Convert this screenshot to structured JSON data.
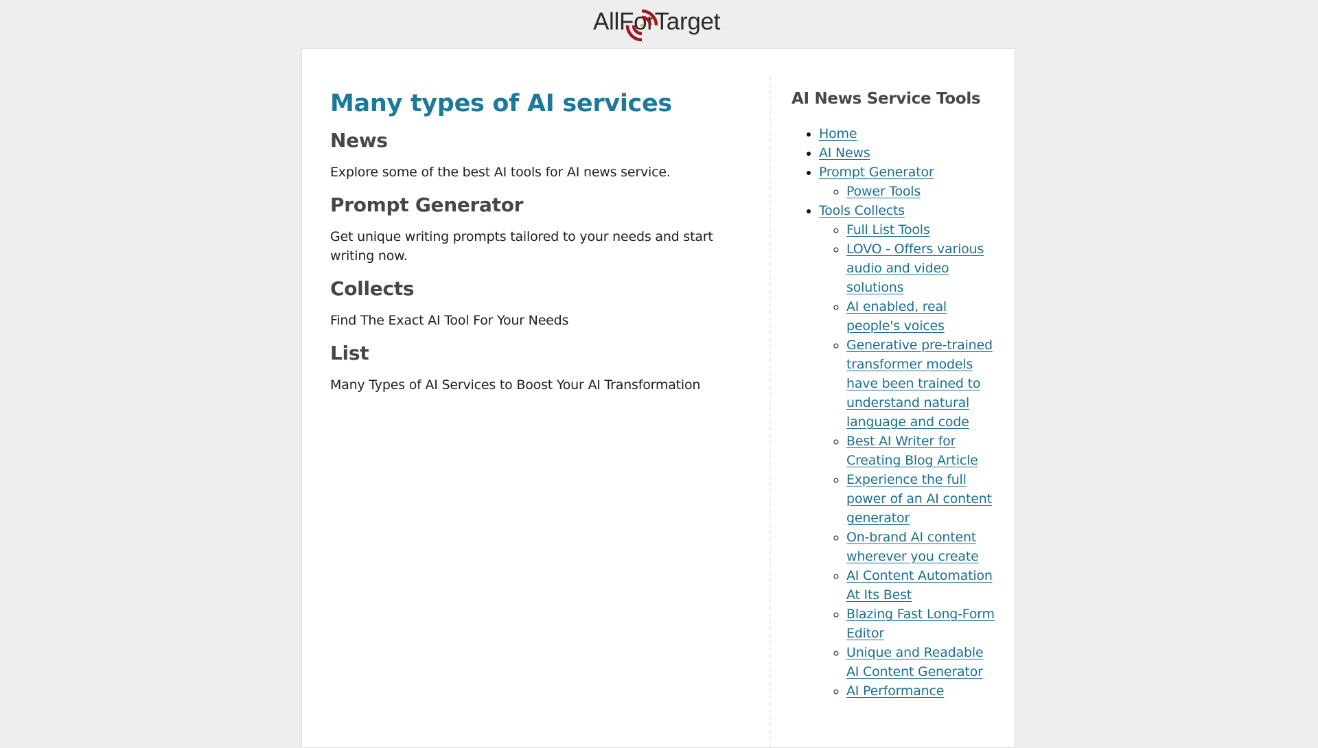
{
  "header": {
    "logo_text": "AllForTarget",
    "brand_colors": {
      "text": "#2a2a2a",
      "mark": "#9b1b1f"
    }
  },
  "main": {
    "title": "Many types of AI services",
    "title_color": "#1b7a9a",
    "sections": [
      {
        "heading": "News",
        "text": "Explore some of the best AI tools for AI news service."
      },
      {
        "heading": "Prompt Generator",
        "text": "Get unique writing prompts tailored to your needs and start writing now."
      },
      {
        "heading": "Collects",
        "text": "Find The Exact AI Tool For Your Needs"
      },
      {
        "heading": "List",
        "text": "Many Types of AI Services to Boost Your AI Transformation"
      }
    ]
  },
  "sidebar": {
    "title": "AI News Service Tools",
    "link_color": "#1a6f8f",
    "items": [
      {
        "label": "Home"
      },
      {
        "label": "AI News"
      },
      {
        "label": "Prompt Generator",
        "children": [
          {
            "label": "Power Tools"
          }
        ]
      },
      {
        "label": "Tools Collects",
        "children": [
          {
            "label": "Full List Tools"
          },
          {
            "label": "LOVO - Offers various audio and video solutions"
          },
          {
            "label": "AI enabled, real people's voices"
          },
          {
            "label": "Generative pre-trained transformer models have been trained to understand natural language and code"
          },
          {
            "label": "Best AI Writer for Creating Blog Article"
          },
          {
            "label": "Experience the full power of an AI content generator"
          },
          {
            "label": "On-brand AI content wherever you create"
          },
          {
            "label": "AI Content Automation At Its Best"
          },
          {
            "label": "Blazing Fast Long-Form Editor"
          },
          {
            "label": "Unique and Readable AI Content Generator"
          },
          {
            "label": "AI Performance"
          }
        ]
      }
    ]
  }
}
